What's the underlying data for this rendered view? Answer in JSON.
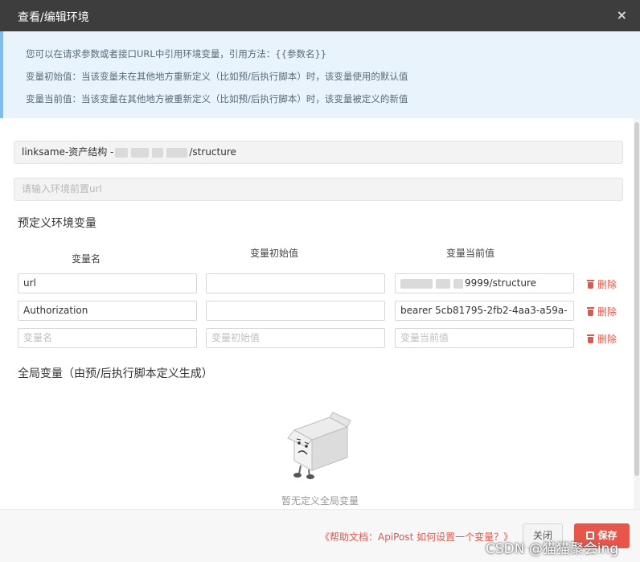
{
  "dialog": {
    "title": "查看/编辑环境",
    "close_glyph": "×"
  },
  "info": {
    "line1": "您可以在请求参数或者接口URL中引用环境变量，引用方法：{{参数名}}",
    "line2": "变量初始值：当该变量未在其他地方重新定义（比如预/后执行脚本）时，该变量使用的默认值",
    "line3": "变量当前值：当该变量在其他地方被重新定义（比如预/后执行脚本）时，该变量被定义的新值"
  },
  "env": {
    "name_prefix": "linksame-资产结构 -",
    "name_suffix": "/structure",
    "url_placeholder": "请输入环境前置url"
  },
  "predefined": {
    "title": "预定义环境变量",
    "col_name": "变量名",
    "col_initial": "变量初始值",
    "col_current": "变量当前值",
    "rows": [
      {
        "name": "url",
        "initial": "",
        "current": "9999/structure"
      },
      {
        "name": "Authorization",
        "initial": "",
        "current": "bearer 5cb81795-2fb2-4aa3-a59a-"
      }
    ],
    "new_row": {
      "name_placeholder": "变量名",
      "initial_placeholder": "变量初始值",
      "current_placeholder": "变量当前值"
    },
    "delete_label": "删除"
  },
  "global": {
    "title": "全局变量（由预/后执行脚本定义生成）",
    "empty_text": "暂无定义全局变量"
  },
  "footer": {
    "help_link": "《帮助文档：ApiPost 如何设置一个变量？》",
    "close_label": "关闭",
    "save_label": "保存"
  },
  "watermark": "CSDN @猫猫聚会ing",
  "colors": {
    "titlebar": "#3d3d3d",
    "info_bg": "#e8f3fb",
    "accent_red": "#e8554a"
  }
}
